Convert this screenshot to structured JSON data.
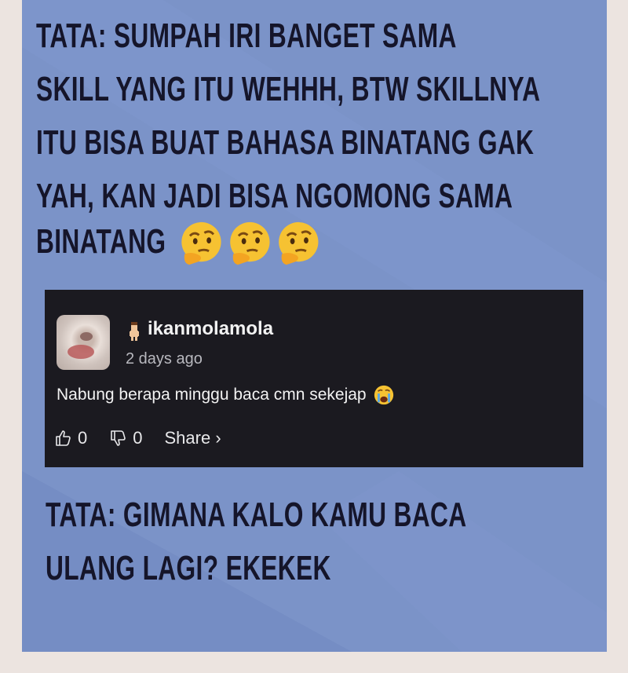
{
  "captions": {
    "top_lines": [
      "TATA: SUMPAH IRI BANGET SAMA",
      "SKILL YANG ITU WEHHH, BTW SKILLNYA",
      "ITU BISA BUAT BAHASA BINATANG GAK",
      "YAH, KAN JADI BISA NGOMONG SAMA",
      "BINATANG"
    ],
    "bottom_lines": [
      "TATA: GIMANA KALO KAMU BACA",
      "ULANG LAGI? EKEKEK"
    ]
  },
  "comment": {
    "username": "ikanmolamola",
    "time": "2 days ago",
    "text": "Nabung berapa minggu baca cmn sekejap",
    "likes": "0",
    "dislikes": "0",
    "share_label": "Share ›"
  },
  "colors": {
    "panel": "#7b93c8",
    "page_bg": "#ece4e0",
    "comment_bg": "#1b1a20",
    "caption_text": "#15152a"
  },
  "icons": [
    "thinking-face-emoji",
    "crying-face-emoji",
    "user-figure-icon",
    "thumbs-up-icon",
    "thumbs-down-icon"
  ]
}
